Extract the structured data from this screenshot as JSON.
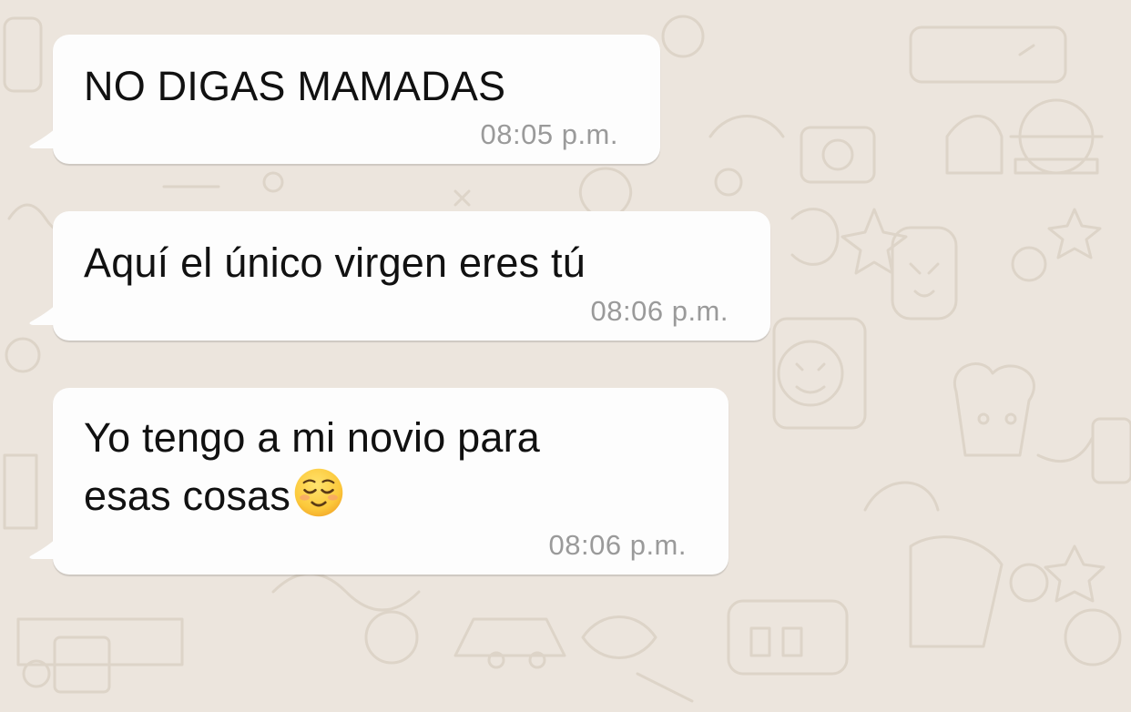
{
  "messages": [
    {
      "text": "NO DIGAS MAMADAS",
      "time": "08:05 p.m."
    },
    {
      "text": "Aquí el único virgen eres tú",
      "time": "08:06 p.m."
    },
    {
      "line1": "Yo tengo a mi novio para",
      "line2": "esas cosas",
      "emoji": "relieved-face-emoji",
      "time": "08:06 p.m."
    }
  ],
  "colors": {
    "wallpaper": "#ece5dd",
    "bubble": "#fdfdfd",
    "text": "#111111",
    "timestamp": "#9a9a9a"
  }
}
